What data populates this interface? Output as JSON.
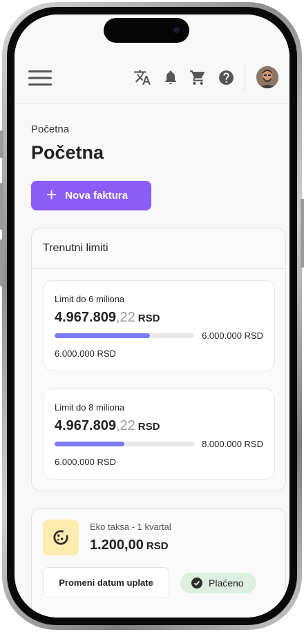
{
  "breadcrumb": "Početna",
  "page_title": "Početna",
  "new_invoice_label": "Nova faktura",
  "limits_card": {
    "title": "Trenutni limiti",
    "items": [
      {
        "label": "Limit do 6 miliona",
        "amount_int": "4.967.809",
        "amount_dec": ",22",
        "currency": "RSD",
        "max": "6.000.000 RSD",
        "remaining": "6.000.000 RSD",
        "progress": 0.685
      },
      {
        "label": "Limit do 8 miliona",
        "amount_int": "4.967.809",
        "amount_dec": ",22",
        "currency": "RSD",
        "max": "8.000.000 RSD",
        "remaining": "6.000.000 RSD",
        "progress": 0.5
      }
    ]
  },
  "tax_card": {
    "name": "Eko taksa - 1 kvartal",
    "amount": "1.200,00",
    "currency": "RSD",
    "change_date_label": "Promeni datum uplate",
    "status": "Plaćeno"
  },
  "colors": {
    "accent": "#8b5cf6",
    "progress": "#7c7cf0",
    "paid_bg": "#dcefe0",
    "tax_icon_bg": "#fdebb0"
  },
  "icons": [
    "menu-icon",
    "translate-icon",
    "bell-icon",
    "cart-icon",
    "help-icon",
    "avatar",
    "plus-icon",
    "cookie-icon",
    "check-circle-icon"
  ]
}
